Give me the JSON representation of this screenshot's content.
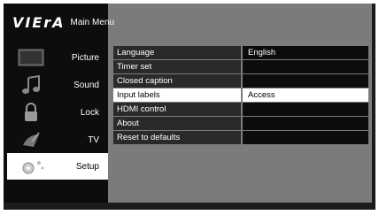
{
  "header": {
    "logo": "VIErA",
    "title": "Main Menu"
  },
  "sidebar": {
    "items": [
      {
        "label": "Picture",
        "icon": "picture-icon"
      },
      {
        "label": "Sound",
        "icon": "music-note-icon"
      },
      {
        "label": "Lock",
        "icon": "padlock-icon"
      },
      {
        "label": "TV",
        "icon": "satellite-dish-icon"
      },
      {
        "label": "Setup",
        "icon": "setup-icon",
        "active": true
      }
    ]
  },
  "menu": {
    "rows": [
      {
        "name": "Language",
        "value": "English"
      },
      {
        "name": "Timer set",
        "value": ""
      },
      {
        "name": "Closed caption",
        "value": ""
      },
      {
        "name": "Input labels",
        "value": "Access",
        "selected": true
      },
      {
        "name": "HDMI control",
        "value": ""
      },
      {
        "name": "About",
        "value": ""
      },
      {
        "name": "Reset to defaults",
        "value": ""
      }
    ]
  },
  "colors": {
    "background": "#1b1b1b",
    "content": "#7b7b7b",
    "highlight": "#ffffff"
  }
}
